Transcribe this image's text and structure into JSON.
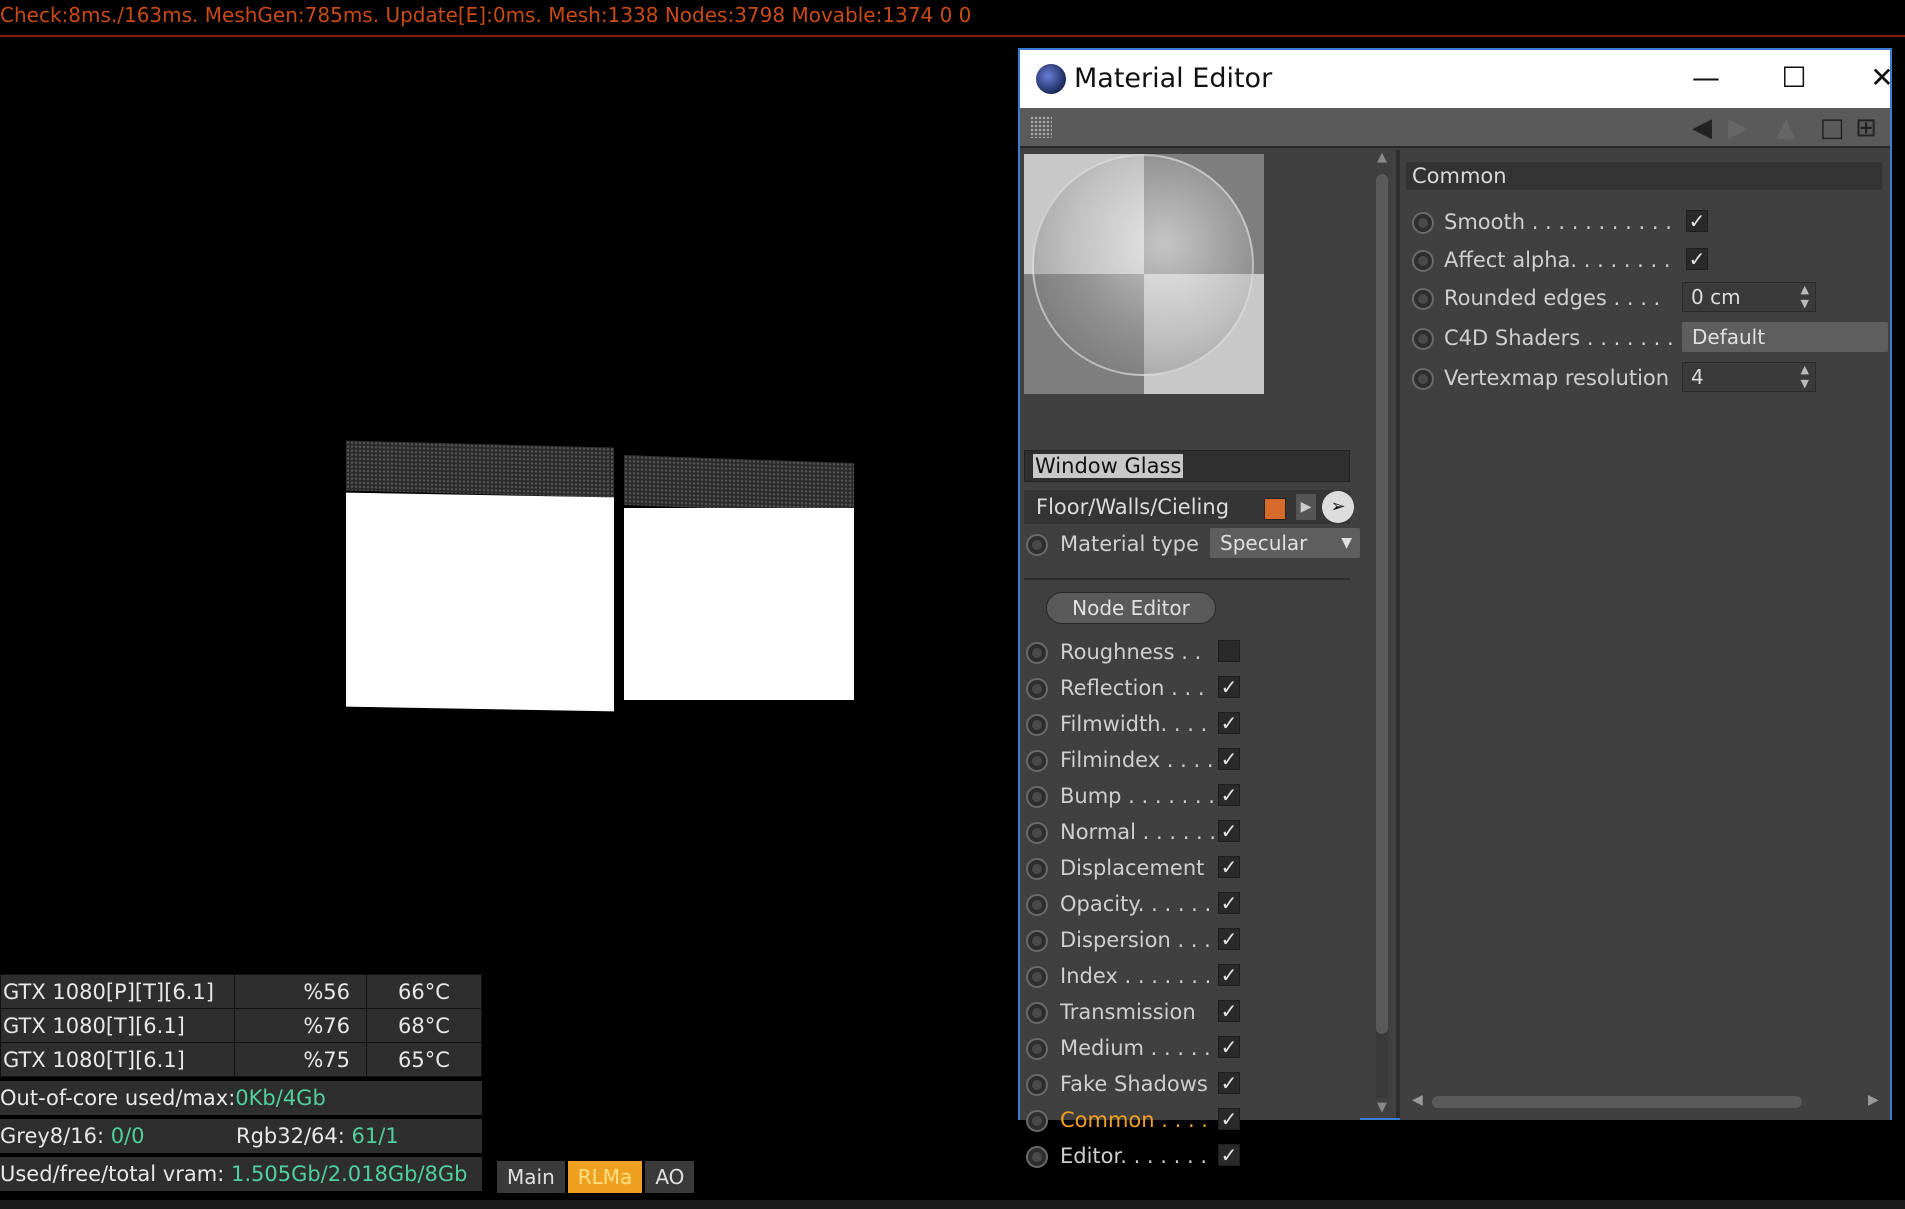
{
  "status_bar": "Check:8ms./163ms. MeshGen:785ms. Update[E]:0ms. Mesh:1338 Nodes:3798 Movable:1374  0 0",
  "gpus": [
    {
      "name": "GTX 1080[P][T][6.1]",
      "usage": "%56",
      "temp": "66°C"
    },
    {
      "name": "GTX 1080[T][6.1]",
      "usage": "%76",
      "temp": "68°C"
    },
    {
      "name": "GTX 1080[T][6.1]",
      "usage": "%75",
      "temp": "65°C"
    }
  ],
  "out_of_core": {
    "label": "Out-of-core used/max:",
    "value": "0Kb/4Gb"
  },
  "grey": {
    "label": "Grey8/16: ",
    "value": "0/0"
  },
  "rgb": {
    "label": "Rgb32/64: ",
    "value": "61/1"
  },
  "vram": {
    "label": "Used/free/total vram: ",
    "value": "1.505Gb/2.018Gb/8Gb"
  },
  "viewport_tabs": [
    "Main",
    "RLMa",
    "AO"
  ],
  "editor": {
    "title": "Material Editor",
    "material_name": "Window Glass",
    "layer": "Floor/Walls/Cieling",
    "material_type_label": "Material type",
    "material_type": "Specular",
    "node_editor": "Node Editor",
    "channels": [
      {
        "label": "Roughness . .",
        "checked": false
      },
      {
        "label": "Reflection . . .",
        "checked": true
      },
      {
        "label": "Filmwidth. . . .",
        "checked": true
      },
      {
        "label": "Filmindex . . . .",
        "checked": true
      },
      {
        "label": "Bump . . . . . . .",
        "checked": true
      },
      {
        "label": "Normal . . . . . .",
        "checked": true
      },
      {
        "label": "Displacement",
        "checked": true
      },
      {
        "label": "Opacity. . . . . .",
        "checked": true
      },
      {
        "label": "Dispersion . . .",
        "checked": true
      },
      {
        "label": "Index . . . . . . .",
        "checked": true
      },
      {
        "label": "Transmission",
        "checked": true
      },
      {
        "label": "Medium . . . . .",
        "checked": true
      },
      {
        "label": "Fake Shadows",
        "checked": true
      },
      {
        "label": "Common . . . .",
        "checked": true,
        "active": true
      },
      {
        "label": "Editor. . . . . . .",
        "checked": true
      }
    ],
    "section": "Common",
    "props": {
      "smooth": "Smooth . . . . . . . . . . .",
      "affect_alpha": "Affect alpha. . . . . . . .",
      "rounded_edges": "Rounded edges . . . .",
      "rounded_edges_value": "0 cm",
      "c4d_shaders": "C4D Shaders . . . . . . .",
      "c4d_shaders_value": "Default",
      "vertexmap": "Vertexmap resolution",
      "vertexmap_value": "4"
    }
  }
}
